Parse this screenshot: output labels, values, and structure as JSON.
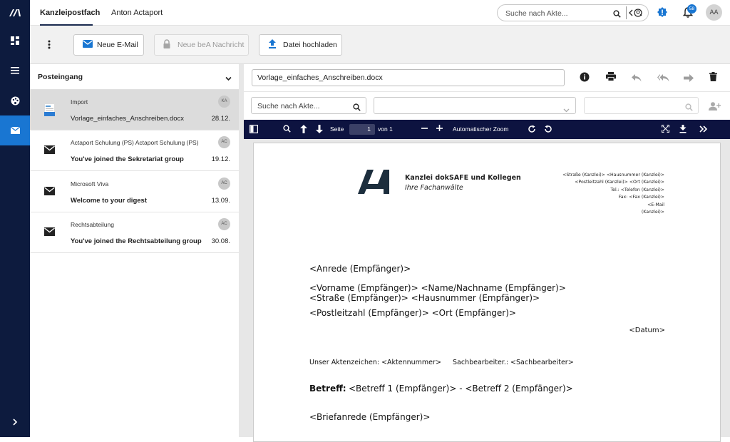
{
  "top_nav": {
    "tab_inbox": "Kanzleipostfach",
    "tab_user": "Anton Actaport",
    "search_placeholder": "Suche nach Akte...",
    "notification_count": "58",
    "avatar_initials": "AA"
  },
  "toolbar": {
    "new_email": "Neue E-Mail",
    "new_bea": "Neue beA Nachricht",
    "upload": "Datei hochladen"
  },
  "inbox": {
    "folder": "Posteingang",
    "messages": [
      {
        "from": "Import",
        "subject": "Vorlage_einfaches_Anschreiben.docx",
        "date": "28.12.",
        "avatar": "KA",
        "selected": true,
        "bold": false
      },
      {
        "from": "Actaport Schulung (PS) Actaport Schulung (PS)",
        "subject": "You've joined the Sekretariat group",
        "date": "19.12.",
        "avatar": "AC",
        "selected": false,
        "bold": true
      },
      {
        "from": "Microsoft Viva",
        "subject": "Welcome to your digest",
        "date": "13.09.",
        "avatar": "AC",
        "selected": false,
        "bold": true
      },
      {
        "from": "Rechtsabteilung",
        "subject": "You've joined the Rechtsabteilung group",
        "date": "30.08.",
        "avatar": "AC",
        "selected": false,
        "bold": true
      }
    ]
  },
  "preview": {
    "filename": "Vorlage_einfaches_Anschreiben.docx",
    "akte_search_placeholder": "Suche nach Akte...",
    "pdf_toolbar": {
      "page_label": "Seite",
      "page_value": "1",
      "page_of": "von 1",
      "zoom": "Automatischer Zoom"
    },
    "document": {
      "firm_name": "Kanzlei dokSAFE und Kollegen",
      "firm_sub": "Ihre Fachanwälte",
      "address_lines": [
        "<Straße (Kanzlei)> <Hausnummer (Kanzlei)>",
        "<Postleitzahl (Kanzlei)> <Ort (Kanzlei)>",
        "Tel.: <Telefon (Kanzlei)>",
        "Fax: <Fax (Kanzlei)>",
        "<E-Mail",
        "(Kanzlei)>"
      ],
      "anrede": "<Anrede (Empfänger)>",
      "name": "<Vorname (Empfänger)> <Name/Nachname (Empfänger)>",
      "strasse": "<Straße (Empfänger)> <Hausnummer (Empfänger)>",
      "ort": "<Postleitzahl (Empfänger)> <Ort (Empfänger)>",
      "datum": "<Datum>",
      "aktenzeichen": "Unser Aktenzeichen: <Aktennummer>",
      "sachbearbeiter": "Sachbearbeiter.: <Sachbearbeiter>",
      "betreff_label": "Betreff:",
      "betreff": "<Betreff 1 (Empfänger)> - <Betreff 2 (Empfänger)>",
      "briefanrede": "<Briefanrede (Empfänger)>"
    }
  },
  "colors": {
    "sidebar": "#0d1b3e",
    "accent": "#1976d2",
    "pdf_toolbar": "#0d1340"
  }
}
